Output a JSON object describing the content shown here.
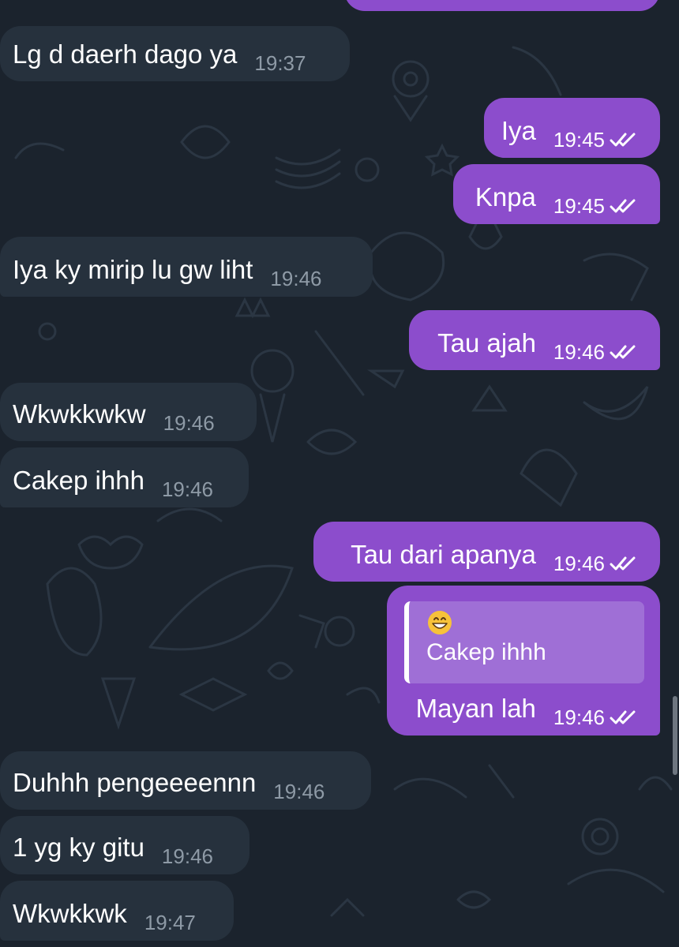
{
  "chat": {
    "messages": [
      {
        "id": "m0",
        "direction": "out",
        "text": "",
        "time": "",
        "ticks": "none"
      },
      {
        "id": "m1",
        "direction": "in",
        "text": "Lg d daerh dago ya",
        "time": "19:37"
      },
      {
        "id": "m2",
        "direction": "out",
        "text": "Iya",
        "time": "19:45",
        "ticks": "read"
      },
      {
        "id": "m3",
        "direction": "out",
        "text": "Knpa",
        "time": "19:45",
        "ticks": "read"
      },
      {
        "id": "m4",
        "direction": "in",
        "text": "Iya ky mirip lu gw liht",
        "time": "19:46"
      },
      {
        "id": "m5",
        "direction": "out",
        "text": "Tau ajah",
        "time": "19:46",
        "ticks": "read"
      },
      {
        "id": "m6",
        "direction": "in",
        "text": "Wkwkkwkw",
        "time": "19:46"
      },
      {
        "id": "m7",
        "direction": "in",
        "text": "Cakep ihhh",
        "time": "19:46"
      },
      {
        "id": "m8",
        "direction": "out",
        "text": "Tau dari apanya",
        "time": "19:46",
        "ticks": "read"
      },
      {
        "id": "m9",
        "direction": "out",
        "text": "Mayan lah",
        "time": "19:46",
        "ticks": "read",
        "reply_to": {
          "emoji": "grinning-face-icon",
          "text": "Cakep ihhh"
        }
      },
      {
        "id": "m10",
        "direction": "in",
        "text": "Duhhh pengeeeennn",
        "time": "19:46"
      },
      {
        "id": "m11",
        "direction": "in",
        "text": "1 yg ky gitu",
        "time": "19:46"
      },
      {
        "id": "m12",
        "direction": "in",
        "text": "Wkwkkwk",
        "time": "19:47"
      }
    ]
  },
  "theme": {
    "background": "#1b232d",
    "incoming_bubble": "#26313d",
    "outgoing_bubble": "#8c4dcc",
    "reply_quote_bg": "#9f6fd6",
    "incoming_time_color": "#8e9aa6",
    "text_color": "#ffffff"
  }
}
